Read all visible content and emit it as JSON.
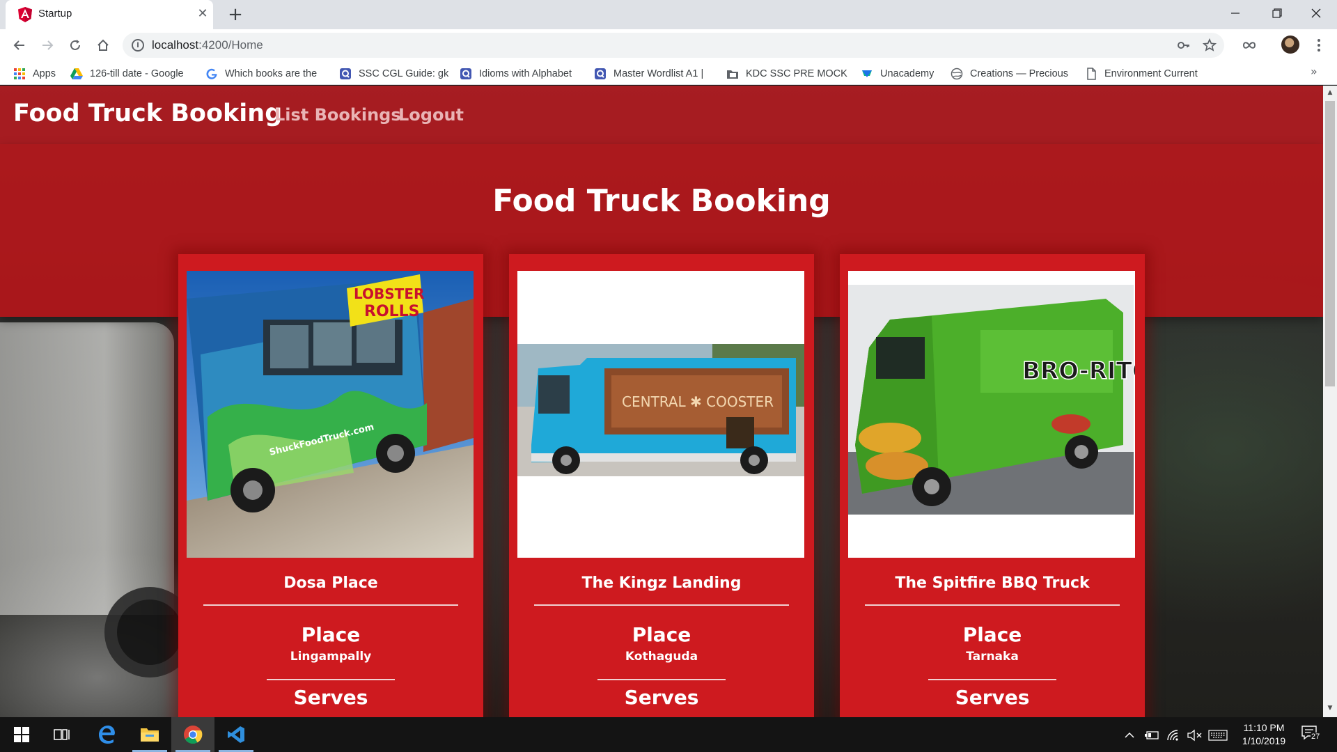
{
  "browser": {
    "tab_title": "Startup",
    "tab_close": "✕",
    "new_tab": "+",
    "url_host": "localhost",
    "url_rest": ":4200/Home",
    "bookmarks": [
      {
        "label": "Apps",
        "icon": "apps-grid-icon"
      },
      {
        "label": "126-till date - Google",
        "icon": "google-drive-icon"
      },
      {
        "label": "Which books are the",
        "icon": "google-icon"
      },
      {
        "label": "SSC CGL Guide: gk",
        "icon": "quizlet-icon"
      },
      {
        "label": "Idioms with Alphabet",
        "icon": "quizlet-icon"
      },
      {
        "label": "Master Wordlist A1 |",
        "icon": "quizlet-icon"
      },
      {
        "label": "KDC SSC PRE MOCK",
        "icon": "folder-image-icon"
      },
      {
        "label": "Unacademy",
        "icon": "unacademy-icon"
      },
      {
        "label": "Creations — Precious",
        "icon": "globe-icon"
      },
      {
        "label": "Environment Current",
        "icon": "document-icon"
      }
    ],
    "bookmarks_more": "»"
  },
  "navbar": {
    "brand": "Food Truck Booking",
    "links": [
      "List Bookings",
      "Logout"
    ]
  },
  "hero": {
    "title": "Food Truck Booking"
  },
  "cards": [
    {
      "name": "Dosa Place",
      "place_label": "Place",
      "place": "Lingampally",
      "serves_label": "Serves",
      "image": "lobster-rolls-truck-photo"
    },
    {
      "name": "The Kingz Landing",
      "place_label": "Place",
      "place": "Kothaguda",
      "serves_label": "Serves",
      "image": "central-coaster-truck-photo"
    },
    {
      "name": "The Spitfire BBQ Truck",
      "place_label": "Place",
      "place": "Tarnaka",
      "serves_label": "Serves",
      "image": "bro-ritos-truck-photo"
    }
  ],
  "truck_signs": {
    "shuck_sign_top": "LOBSTER",
    "shuck_sign_bottom": "ROLLS",
    "shuck_side": "ShuckFoodTruck.com",
    "coaster_sign": "CENTRAL ✱ COOSTER",
    "broritos_sign": "BRO-RITOS"
  },
  "taskbar": {
    "time": "11:10 PM",
    "date": "1/10/2019",
    "notifications": "27"
  },
  "colors": {
    "navbar": "#be161c",
    "hero": "#c81216",
    "card": "#ce1a1f",
    "link": "#e9b4b5"
  }
}
